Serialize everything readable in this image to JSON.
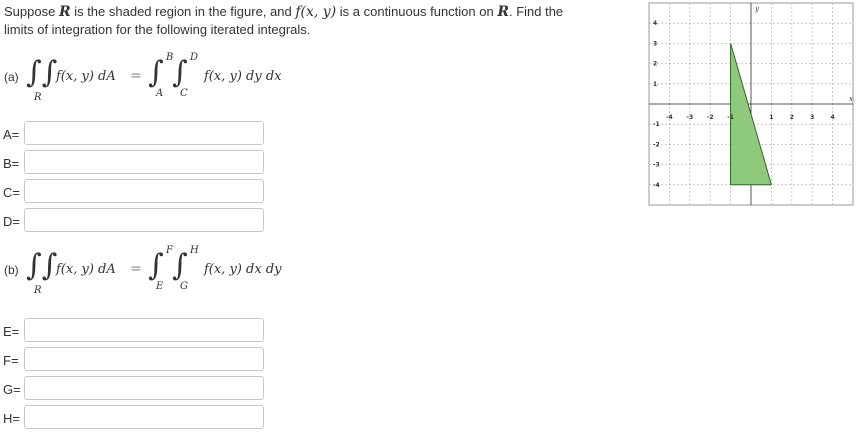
{
  "problem": {
    "pre": "Suppose ",
    "region": "R",
    "mid1": " is the shaded region in the figure, and ",
    "func": "f(x, y)",
    "mid2": " is a continuous function on ",
    "region2": "R",
    "post": ". Find the",
    "line2": "limits of integration for the following iterated integrals."
  },
  "part_a": {
    "label": "(a)",
    "lhs": "f(x, y) dA",
    "region_sub": "R",
    "equals": "=",
    "upper_outer": "B",
    "lower_outer": "A",
    "upper_inner": "D",
    "lower_inner": "C",
    "integrand": "f(x, y) dy dx"
  },
  "part_b": {
    "label": "(b)",
    "lhs": "f(x, y) dA",
    "region_sub": "R",
    "equals": "=",
    "upper_outer": "F",
    "lower_outer": "E",
    "upper_inner": "H",
    "lower_inner": "G",
    "integrand": "f(x, y) dx dy"
  },
  "fields": [
    {
      "label": "A=",
      "value": ""
    },
    {
      "label": "B=",
      "value": ""
    },
    {
      "label": "C=",
      "value": ""
    },
    {
      "label": "D=",
      "value": ""
    },
    {
      "label": "E=",
      "value": ""
    },
    {
      "label": "F=",
      "value": ""
    },
    {
      "label": "G=",
      "value": ""
    },
    {
      "label": "H=",
      "value": ""
    }
  ],
  "graph": {
    "x_axis_label": "x",
    "y_axis_label": "y",
    "x_ticks": [
      "-4",
      "-3",
      "-2",
      "-1",
      "1",
      "2",
      "3",
      "4"
    ],
    "y_ticks": [
      "4",
      "3",
      "2",
      "1",
      "-1",
      "-2",
      "-3",
      "-4"
    ],
    "x_range": [
      -5,
      5
    ],
    "y_range": [
      -5,
      5
    ],
    "region_vertices": [
      [
        -1,
        3
      ],
      [
        -1,
        -4
      ],
      [
        1,
        -4
      ]
    ],
    "region_fill": "#8fca7c",
    "region_stroke": "#2b6a24",
    "grid": "dashed"
  }
}
